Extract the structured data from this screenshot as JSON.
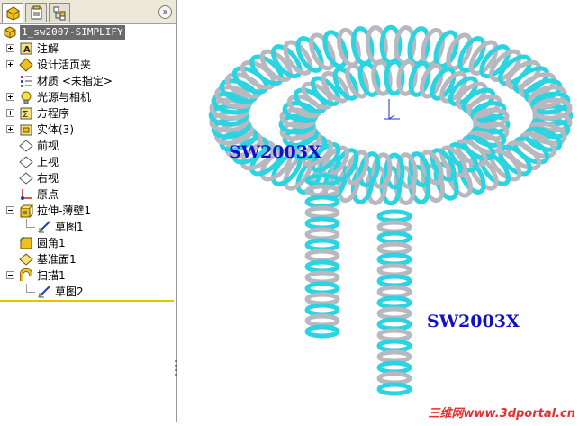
{
  "feature_tree": {
    "root_label": "1_sw2007-SIMPLIFY",
    "items": [
      {
        "label": "注解",
        "icon": "annotation-icon",
        "expandable": true
      },
      {
        "label": "设计活页夹",
        "icon": "design-binder-icon",
        "expandable": true
      },
      {
        "label": "材质 <未指定>",
        "icon": "material-icon",
        "expandable": false
      },
      {
        "label": "光源与相机",
        "icon": "lights-camera-icon",
        "expandable": true
      },
      {
        "label": "方程序",
        "icon": "equations-icon",
        "expandable": true
      },
      {
        "label": "实体(3)",
        "icon": "solid-bodies-icon",
        "expandable": true
      },
      {
        "label": "前视",
        "icon": "plane-icon",
        "expandable": false
      },
      {
        "label": "上视",
        "icon": "plane-icon",
        "expandable": false
      },
      {
        "label": "右视",
        "icon": "plane-icon",
        "expandable": false
      },
      {
        "label": "原点",
        "icon": "origin-icon",
        "expandable": false
      },
      {
        "label": "拉伸-薄壁1",
        "icon": "extrude-icon",
        "expandable": true,
        "expanded": true
      },
      {
        "label": "草图1",
        "icon": "sketch-icon",
        "child": true
      },
      {
        "label": "圆角1",
        "icon": "fillet-icon",
        "expandable": false
      },
      {
        "label": "基准面1",
        "icon": "plane-icon",
        "expandable": false
      },
      {
        "label": "扫描1",
        "icon": "sweep-icon",
        "expandable": true,
        "expanded": true
      },
      {
        "label": "草图2",
        "icon": "sketch-icon",
        "child": true
      }
    ]
  },
  "tabs": [
    {
      "name": "feature-manager-tab",
      "icon": "feature-manager-icon",
      "active": true
    },
    {
      "name": "property-manager-tab",
      "icon": "property-manager-icon",
      "active": false
    },
    {
      "name": "configuration-manager-tab",
      "icon": "configuration-manager-icon",
      "active": false
    }
  ],
  "collapse_button": "»",
  "viewport": {
    "label_top": "SW2003X",
    "label_bottom": "SW2003X",
    "watermark": "三维网www.3dportal.cn"
  },
  "colors": {
    "coil_cyan": "#2ad4e0",
    "coil_gray": "#b8b8c0",
    "label_blue": "#1010c8",
    "watermark_red": "#e83030"
  }
}
